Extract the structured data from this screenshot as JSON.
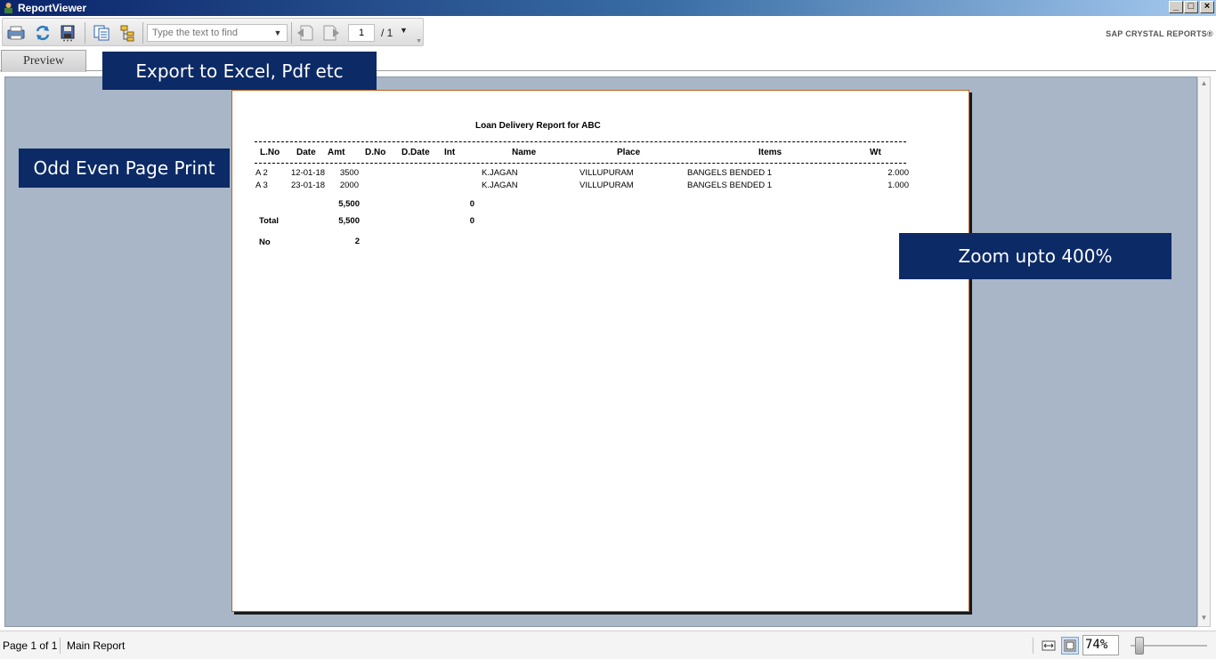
{
  "window": {
    "title": "ReportViewer"
  },
  "toolbar": {
    "search_placeholder": "Type the text to find",
    "current_page": "1",
    "total_pages": "/ 1",
    "brand": "SAP CRYSTAL REPORTS®"
  },
  "tabs": [
    {
      "label": "Preview"
    }
  ],
  "report": {
    "title": "Loan Delivery Report for  ABC",
    "headers": [
      "L.No",
      "Date",
      "Amt",
      "D.No",
      "D.Date",
      "Int",
      "Name",
      "Place",
      "Items",
      "Wt"
    ],
    "rows": [
      {
        "lno": "A 2",
        "date": "12-01-18",
        "amt": "3500",
        "name": "K.JAGAN",
        "place": "VILLUPURAM",
        "items": "BANGELS BENDED 1",
        "wt": "2.000"
      },
      {
        "lno": "A 3",
        "date": "23-01-18",
        "amt": "2000",
        "name": "K.JAGAN",
        "place": "VILLUPURAM",
        "items": "BANGELS BENDED 1",
        "wt": "1.000"
      }
    ],
    "subtotal": {
      "amt": "5,500",
      "int": "0"
    },
    "total": {
      "label": "Total",
      "amt": "5,500",
      "int": "0"
    },
    "count": {
      "label": "No",
      "value": "2"
    }
  },
  "callouts": {
    "export": "Export to Excel, Pdf etc",
    "odd_even": "Odd Even Page Print",
    "zoom": "Zoom upto 400%"
  },
  "status": {
    "page": "Page 1 of 1",
    "report_name": "Main Report",
    "zoom": "74%"
  }
}
